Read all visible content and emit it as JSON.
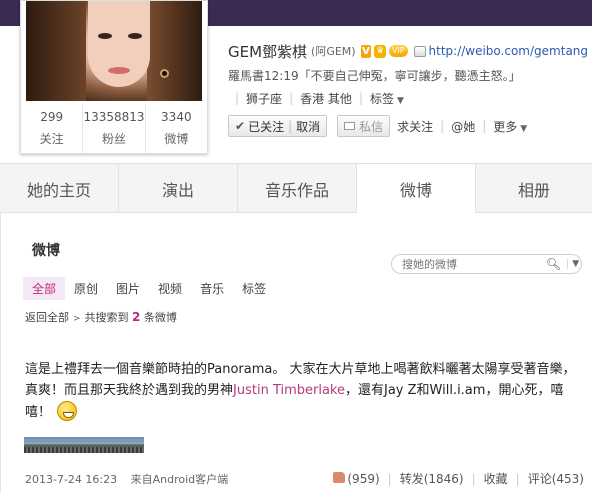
{
  "profile": {
    "name": "GEM鄧紫棋",
    "nickname": "(阿GEM)",
    "verified_badge": "V",
    "member_badge": "VIP",
    "url": "http://weibo.com/gemtang",
    "status": "羅馬書12:19「不要自己伸冤，寧可讓步，聽憑主怒。」",
    "tags": [
      "狮子座",
      "香港 其他",
      "标签"
    ],
    "stats": [
      {
        "value": "299",
        "label": "关注"
      },
      {
        "value": "13358813",
        "label": "粉丝"
      },
      {
        "value": "3340",
        "label": "微博"
      }
    ],
    "actions": {
      "following": "已关注",
      "unfollow": "取消",
      "message": "私信",
      "ask_follow": "求关注",
      "mention": "@她",
      "more": "更多"
    }
  },
  "tabs": [
    "她的主页",
    "演出",
    "音乐作品",
    "微博",
    "相册"
  ],
  "active_tab": "微博",
  "section": {
    "title": "微博",
    "search_placeholder": "搜她的微博"
  },
  "filters": [
    "全部",
    "原创",
    "图片",
    "视频",
    "音乐",
    "标签"
  ],
  "active_filter": "全部",
  "result": {
    "back": "返回全部",
    "prefix": "共搜索到",
    "count": "2",
    "suffix": "条微博"
  },
  "post": {
    "text_before": "這是上禮拜去一個音樂節時拍的Panorama。 大家在大片草地上喝著飲料曬著太陽享受著音樂，真爽！而且那天我終於遇到我的男神",
    "highlight": "Justin Timberlake",
    "text_after": "，還有Jay Z和Will.i.am，開心死，嘻嘻！",
    "timestamp": "2013-7-24 16:23",
    "source": "来自Android客户端",
    "likes": "(959)",
    "repost": "转发(1846)",
    "favorite": "收藏",
    "comment": "评论(453)"
  },
  "colors": {
    "accent": "#c0297b",
    "link": "#2a5db0",
    "cover": "#3a2b55"
  }
}
